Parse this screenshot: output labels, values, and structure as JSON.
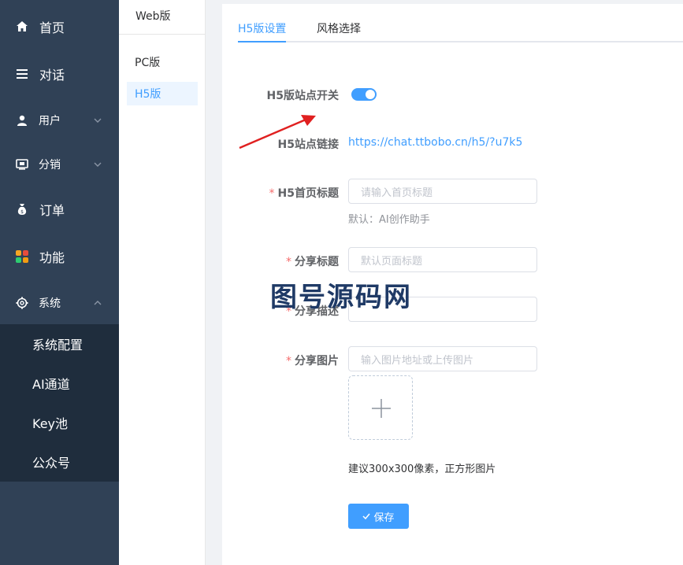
{
  "sidebar": {
    "items": [
      {
        "label": "首页",
        "icon": "home-icon"
      },
      {
        "label": "对话",
        "icon": "menu-icon"
      },
      {
        "label": "用户",
        "icon": "user-icon"
      },
      {
        "label": "分销",
        "icon": "distribution-icon"
      },
      {
        "label": "订单",
        "icon": "money-bag-icon"
      },
      {
        "label": "功能",
        "icon": "apps-icon"
      },
      {
        "label": "系统",
        "icon": "gear-icon"
      }
    ],
    "submenu": [
      "系统配置",
      "AI通道",
      "Key池",
      "公众号"
    ]
  },
  "subnav": {
    "title": "Web版",
    "items": [
      "PC版",
      "H5版"
    ]
  },
  "tabs": [
    "H5版设置",
    "风格选择"
  ],
  "form": {
    "switch_label": "H5版站点开关",
    "link_label": "H5站点链接",
    "link_value": "https://chat.ttbobo.cn/h5/?u7k5",
    "title_label": "H5首页标题",
    "title_placeholder": "请输入首页标题",
    "title_hint": "默认：AI创作助手",
    "share_title_label": "分享标题",
    "share_title_placeholder": "默认页面标题",
    "share_desc_label": "分享描述",
    "share_image_label": "分享图片",
    "share_image_placeholder": "输入图片地址或上传图片",
    "upload_tip": "建议300x300像素，正方形图片",
    "save_label": "保存"
  },
  "watermark": "图号源码网",
  "colors": {
    "accent": "#409eff",
    "sidebar": "#304156",
    "submenu": "#1f2d3d",
    "required": "#f56c6c",
    "arrow": "#e02020"
  }
}
